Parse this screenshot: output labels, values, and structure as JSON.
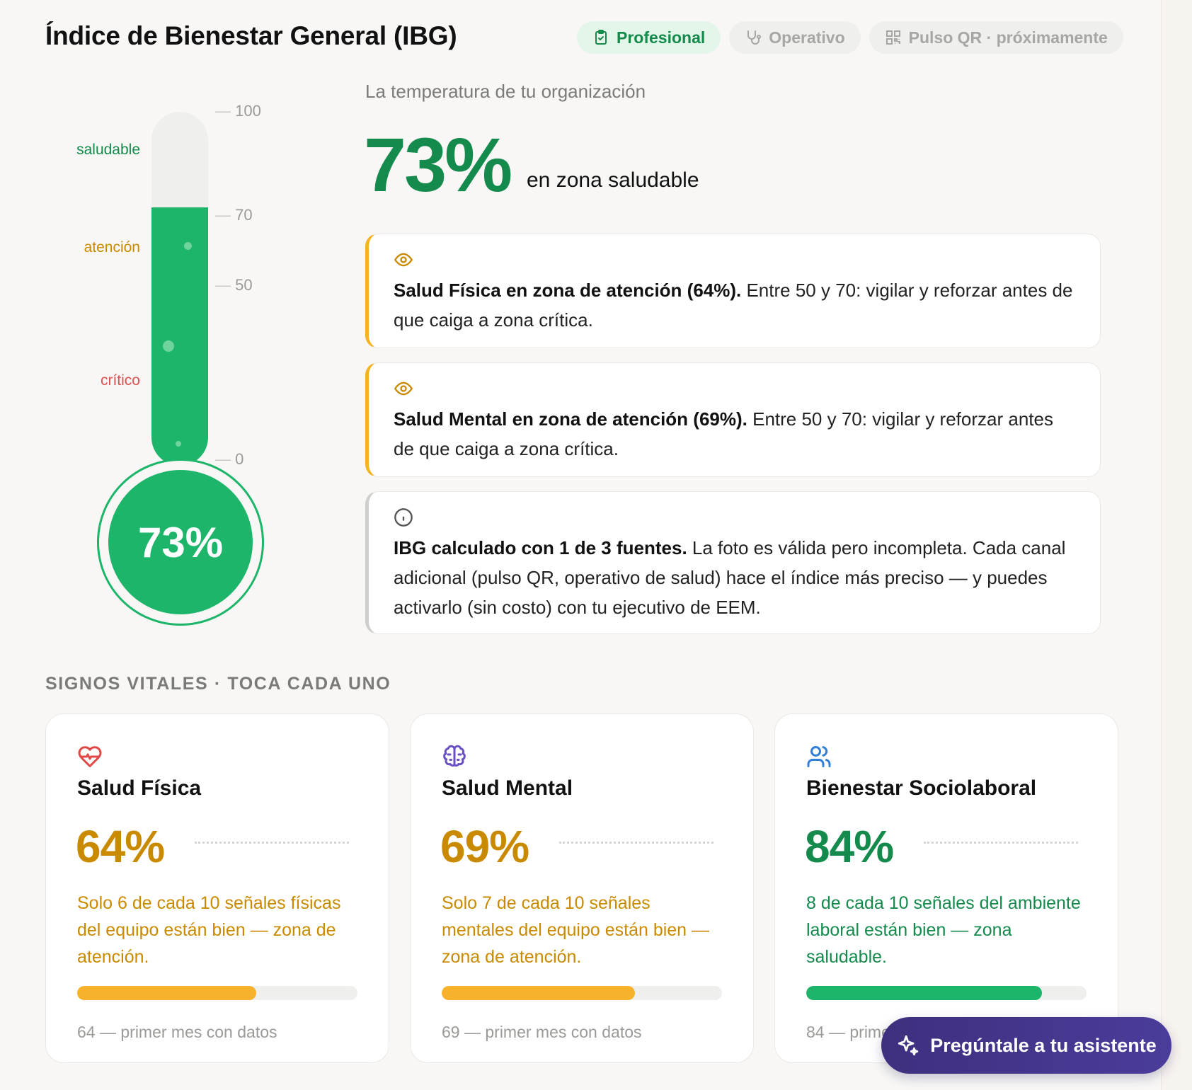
{
  "header": {
    "title": "Índice de Bienestar General (IBG)",
    "tabs": [
      {
        "label": "Profesional",
        "icon": "clipboard-check-icon",
        "active": true
      },
      {
        "label": "Operativo",
        "icon": "stethoscope-icon",
        "active": false
      },
      {
        "label": "Pulso QR · próximamente",
        "icon": "qr-code-icon",
        "active": false
      }
    ]
  },
  "thermometer": {
    "value": 73,
    "value_label": "73%",
    "ticks": [
      "100",
      "70",
      "50",
      "0"
    ],
    "zones": [
      {
        "label": "saludable",
        "color": "#138a4a"
      },
      {
        "label": "atención",
        "color": "#c98a00"
      },
      {
        "label": "crítico",
        "color": "#e05050"
      }
    ],
    "fill_color": "#1cb56a"
  },
  "summary": {
    "subtitle": "La temperatura de tu organización",
    "value": "73%",
    "caption": "en zona saludable"
  },
  "alerts": [
    {
      "icon": "eye-icon",
      "bold": "Salud Física en zona de atención (64%).",
      "text": " Entre 50 y 70: vigilar y reforzar antes de que caiga a zona crítica."
    },
    {
      "icon": "eye-icon",
      "bold": "Salud Mental en zona de atención (69%).",
      "text": " Entre 50 y 70: vigilar y reforzar antes de que caiga a zona crítica."
    },
    {
      "icon": "info-icon",
      "bold": "IBG calculado con 1 de 3 fuentes.",
      "text": " La foto es válida pero incompleta. Cada canal adicional (pulso QR, operativo de salud) hace el índice más preciso — y puedes activarlo (sin costo) con tu ejecutivo de EEM."
    }
  ],
  "vitals": {
    "heading": "SIGNOS VITALES · TOCA CADA UNO",
    "cards": [
      {
        "name": "Salud Física",
        "icon": "heart-pulse-icon",
        "value": "64%",
        "level": 64,
        "color": "#c98a00",
        "bar_color": "#f7b12a",
        "desc": "Solo 6 de cada 10 señales físicas del equipo están bien — zona de atención.",
        "footer": "64 — primer mes con datos"
      },
      {
        "name": "Salud Mental",
        "icon": "brain-icon",
        "value": "69%",
        "level": 69,
        "color": "#c98a00",
        "bar_color": "#f7b12a",
        "desc": "Solo 7 de cada 10 señales mentales del equipo están bien — zona de atención.",
        "footer": "69 — primer mes con datos"
      },
      {
        "name": "Bienestar Sociolaboral",
        "icon": "users-icon",
        "value": "84%",
        "level": 84,
        "color": "#148a4c",
        "bar_color": "#1cb56a",
        "desc": "8 de cada 10 señales del ambiente laboral están bien — zona saludable.",
        "footer": "84 — primer mes con datos"
      }
    ]
  },
  "assistant": {
    "label": "Pregúntale a tu asistente",
    "icon": "sparkles-icon"
  }
}
